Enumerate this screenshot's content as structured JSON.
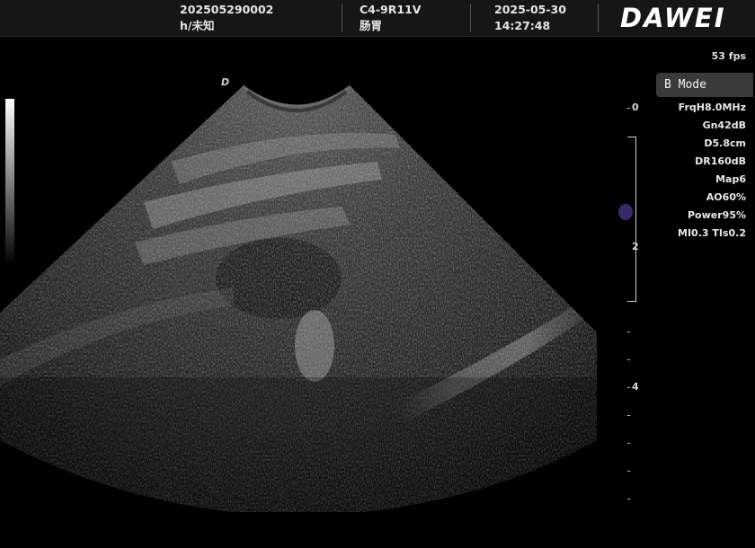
{
  "header": {
    "patient_id": "202505290002",
    "patient_info": "h/未知",
    "probe": "C4-9R11V",
    "exam": "肠胃",
    "date": "2025-05-30",
    "time": "14:27:48",
    "logo": "DAWEI"
  },
  "status": {
    "fps": "53 fps",
    "mode": "B Mode",
    "orientation_marker": "D"
  },
  "params": [
    "FrqH8.0MHz",
    "Gn42dB",
    "D5.8cm",
    "DR160dB",
    "Map6",
    "AO60%",
    "Power95%",
    "MI0.3 TIs0.2"
  ],
  "depth_scale": {
    "labels": [
      "0",
      "2",
      "4"
    ]
  },
  "colors": {
    "background": "#000000",
    "header_bg": "#161616",
    "mode_button_bg": "#3a3a3a",
    "focus_marker": "#3a2a6a"
  }
}
